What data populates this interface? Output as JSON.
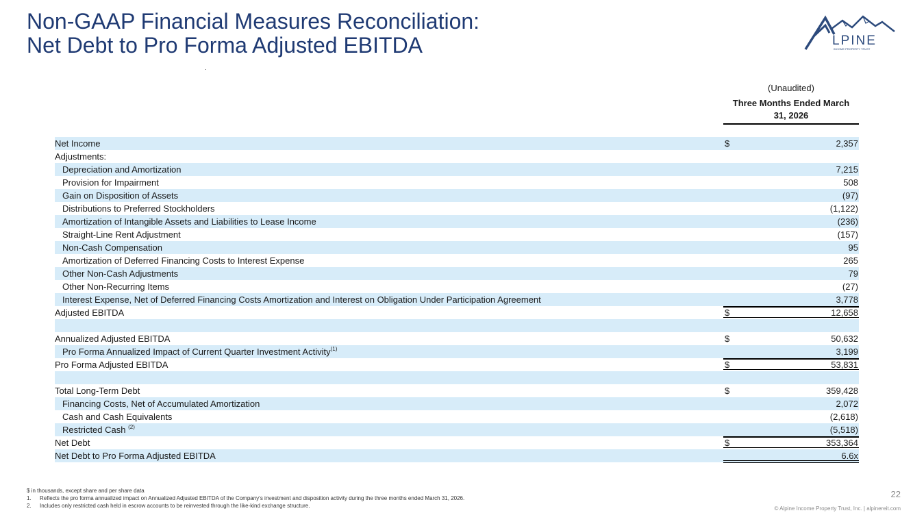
{
  "title": {
    "line1": "Non-GAAP Financial Measures Reconciliation:",
    "line2": "Net Debt to Pro Forma Adjusted EBITDA"
  },
  "logo": {
    "text": "LPINE",
    "subtext": "INCOME PROPERTY TRUST",
    "color": "#2c4a7c"
  },
  "columns": {
    "unaudited": "(Unaudited)",
    "period_line1": "Three Months Ended March",
    "period_line2": "31, 2026"
  },
  "rows": [
    {
      "label": "Net Income",
      "cur": "$",
      "value": "2,357"
    },
    {
      "label": "Adjustments:",
      "cur": "",
      "value": ""
    },
    {
      "label": "Depreciation and Amortization",
      "cur": "",
      "value": "7,215"
    },
    {
      "label": "Provision for Impairment",
      "cur": "",
      "value": "508"
    },
    {
      "label": "Gain on Disposition of Assets",
      "cur": "",
      "value": "(97)"
    },
    {
      "label": "Distributions to Preferred Stockholders",
      "cur": "",
      "value": "(1,122)"
    },
    {
      "label": "Amortization of Intangible Assets and Liabilities to Lease Income",
      "cur": "",
      "value": "(236)"
    },
    {
      "label": "Straight-Line Rent Adjustment",
      "cur": "",
      "value": "(157)"
    },
    {
      "label": "Non-Cash Compensation",
      "cur": "",
      "value": "95"
    },
    {
      "label": "Amortization of Deferred Financing Costs to Interest Expense",
      "cur": "",
      "value": "265"
    },
    {
      "label": "Other Non-Cash Adjustments",
      "cur": "",
      "value": "79"
    },
    {
      "label": "Other Non-Recurring Items",
      "cur": "",
      "value": "(27)"
    },
    {
      "label": "Interest Expense, Net of Deferred Financing Costs Amortization and Interest on Obligation Under Participation Agreement",
      "cur": "",
      "value": "3,778"
    },
    {
      "label": "Adjusted EBITDA",
      "cur": "$",
      "value": "12,658"
    },
    {
      "label": "",
      "cur": "",
      "value": ""
    },
    {
      "label": "Annualized Adjusted EBITDA",
      "cur": "$",
      "value": "50,632"
    },
    {
      "label": "Pro Forma Annualized Impact of Current Quarter Investment Activity",
      "sup": "(1)",
      "cur": "",
      "value": "3,199"
    },
    {
      "label": "Pro Forma Adjusted EBITDA",
      "cur": "$",
      "value": "53,831"
    },
    {
      "label": "",
      "cur": "",
      "value": ""
    },
    {
      "label": "Total Long-Term Debt",
      "cur": "$",
      "value": "359,428"
    },
    {
      "label": "Financing Costs, Net of Accumulated Amortization",
      "cur": "",
      "value": "2,072"
    },
    {
      "label": "Cash and Cash Equivalents",
      "cur": "",
      "value": "(2,618)"
    },
    {
      "label": "Restricted Cash",
      "sup": "(2)",
      "cur": "",
      "value": "(5,518)"
    },
    {
      "label": "Net Debt",
      "cur": "$",
      "value": "353,364"
    },
    {
      "label": "Net Debt to Pro Forma Adjusted EBITDA",
      "cur": "",
      "value": "6.6x"
    }
  ],
  "notes": {
    "intro": "$ in thousands, except share and per share data",
    "items": [
      {
        "num": "1.",
        "text": "Reflects the pro forma annualized impact on Annualized Adjusted EBITDA of the Company’s investment and disposition activity during the three months ended March 31, 2026."
      },
      {
        "num": "2.",
        "text": "Includes only restricted cash held in escrow accounts to be reinvested through the like-kind exchange structure."
      }
    ]
  },
  "page_number": "22",
  "footer": "© Alpine Income Property Trust, Inc.  |  alpinereit.com",
  "colors": {
    "title": "#1f3a73",
    "row_shade": "#d7ecf9",
    "footer": "#8a8a8a"
  }
}
